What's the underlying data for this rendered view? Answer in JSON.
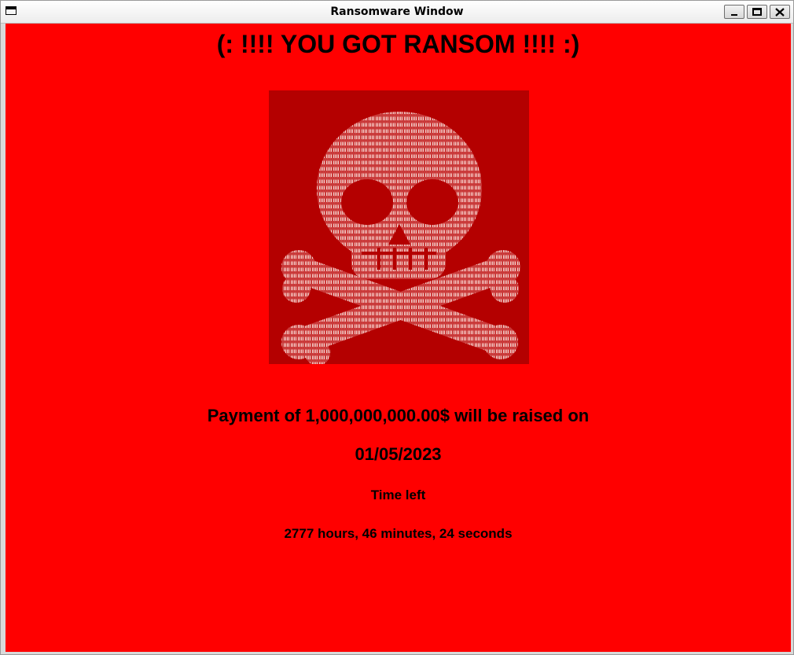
{
  "window": {
    "title": "Ransomware Window"
  },
  "content": {
    "headline": "(: !!!! YOU GOT RANSOM !!!! :)",
    "image": {
      "icon": "skull-and-crossbones-icon",
      "background_color": "#b00000"
    },
    "payment_text": "Payment of 1,000,000,000.00$ will be raised on",
    "deadline_date": "01/05/2023",
    "time_left_label": "Time left",
    "countdown": "2777 hours, 46 minutes, 24 seconds"
  },
  "colors": {
    "background": "#ff0000",
    "text": "#000000"
  }
}
